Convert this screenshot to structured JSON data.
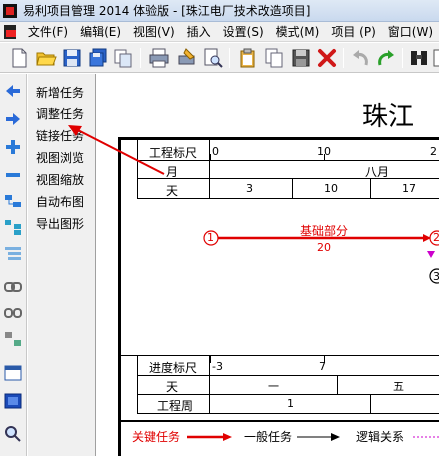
{
  "window": {
    "title": "易利项目管理 2014 体验版 - [珠江电厂技术改造项目]"
  },
  "menu": {
    "items": [
      "文件(F)",
      "编辑(E)",
      "视图(V)",
      "插入",
      "设置(S)",
      "模式(M)",
      "项目 (P)",
      "窗口(W)"
    ]
  },
  "toolbar": {
    "buttons": [
      "new-document-icon",
      "open-folder-icon",
      "save-icon",
      "save-all-icon",
      "copy-icon",
      "print-icon",
      "print-setup-icon",
      "print-preview-icon",
      "clipboard-icon",
      "page-copy-icon",
      "disk-icon",
      "delete-icon",
      "undo-icon",
      "redo-icon",
      "binoculars-icon",
      "grid-icon"
    ]
  },
  "commands": {
    "items": [
      "新增任务",
      "调整任务",
      "链接任务",
      "视图浏览",
      "视图缩放",
      "自动布图",
      "导出图形"
    ]
  },
  "chart": {
    "project_title": "珠江",
    "rows": {
      "scale": "工程标尺",
      "month": "月",
      "day": "天",
      "progress": "进度标尺",
      "day_bottom": "天",
      "week": "工程周"
    },
    "scale_ticks": [
      "0",
      "10",
      "2"
    ],
    "month_value": "八月",
    "day_values": [
      "3",
      "10",
      "17"
    ],
    "progress_ticks": [
      "-3",
      "7"
    ],
    "day_bottom_values": [
      "一",
      "五"
    ],
    "week_value": "1",
    "task": {
      "name": "基础部分",
      "duration": "20",
      "start_node": "1",
      "end_node": "2",
      "next_node": "3"
    },
    "legend": {
      "critical": "关键任务",
      "normal": "一般任务",
      "logic": "逻辑关系"
    }
  },
  "colors": {
    "critical": "#e00000",
    "logic": "#cc00cc",
    "titlebar": "#dfe9f5"
  }
}
